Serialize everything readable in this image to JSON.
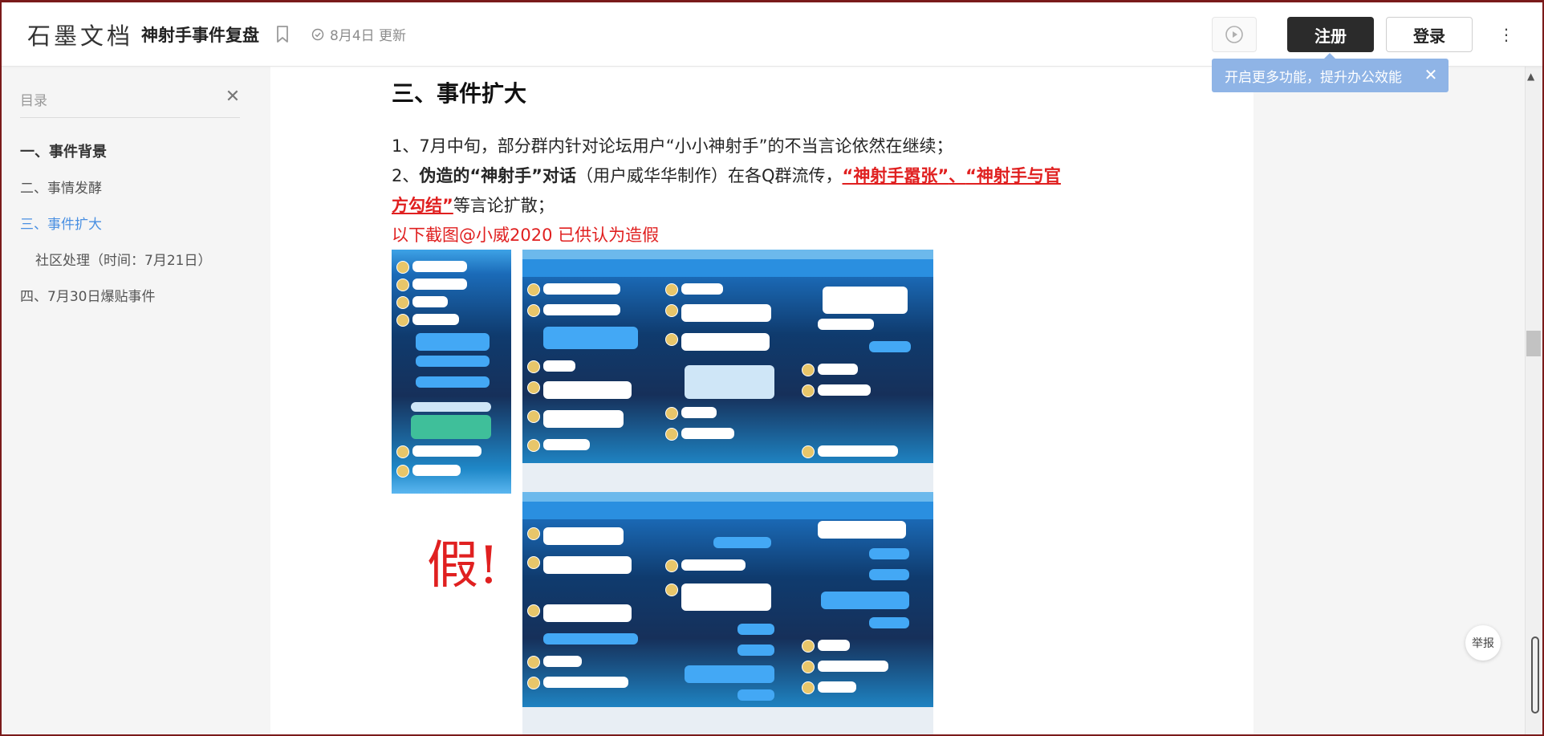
{
  "header": {
    "logo": "石墨文档",
    "doc_title": "神射手事件复盘",
    "updated": "8月4日 更新",
    "register_label": "注册",
    "login_label": "登录",
    "more_label": "⋮"
  },
  "tooltip": {
    "text": "开启更多功能，提升办公效能",
    "close": "✕"
  },
  "sidebar": {
    "title": "目录",
    "close": "✕",
    "items": [
      {
        "label": "一、事件背景"
      },
      {
        "label": "二、事情发酵"
      },
      {
        "label": "三、事件扩大"
      },
      {
        "label": "社区处理（时间：7月21日）"
      },
      {
        "label": "四、7月30日爆贴事件"
      }
    ]
  },
  "doc": {
    "heading": "三、事件扩大",
    "para1": "1、7月中旬，部分群内针对论坛用户“小小神射手”的不当言论依然在继续；",
    "para2_a": "2、",
    "para2_bold": "伪造的“神射手”对话",
    "para2_b": "（用户威华华制作）在各Q群流传，",
    "para2_link1": "“神射手嚣张”",
    "para2_sep": "、",
    "para2_link2a": "“神射手与官",
    "para2_link2b": "方勾结”",
    "para2_end": "等言论扩散；",
    "para3": "以下截图@小威2020 已供认为造假",
    "fake_mark": "假!"
  },
  "report_label": "举报",
  "colors": {
    "accent_blue": "#4a90e2",
    "alert_red": "#e02020",
    "tooltip_bg": "#8fb4e6",
    "register_bg": "#2b2b2b"
  }
}
